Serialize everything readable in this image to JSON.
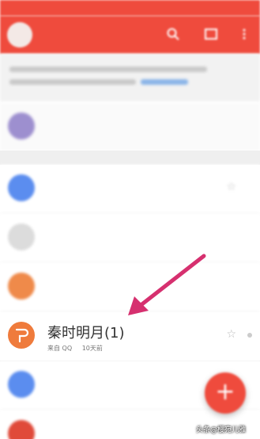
{
  "status_bar": {
    "left": "",
    "right": ""
  },
  "app_bar": {
    "title": "",
    "accent": "#ef4b3d"
  },
  "top_item": {
    "label": "",
    "tag": ""
  },
  "files": [
    {
      "name": "",
      "sub": "",
      "icon_color": "#5b8def"
    },
    {
      "name": "",
      "sub": "",
      "icon_color": "#dcdcdc"
    },
    {
      "name": "",
      "sub": "",
      "icon_color": "#ef8a4a"
    },
    {
      "name": "秦时明月(1)",
      "source": "来自 QQ",
      "time": "10天前",
      "icon_color": "#ef7b3c",
      "icon": "document-icon"
    },
    {
      "name": "",
      "sub": "",
      "icon_color": "#5b8def"
    },
    {
      "name": "",
      "sub": "",
      "icon_color": "#e04a3a"
    }
  ],
  "fab": {
    "label": "+"
  },
  "watermark": "头条@樱宛儿雅"
}
